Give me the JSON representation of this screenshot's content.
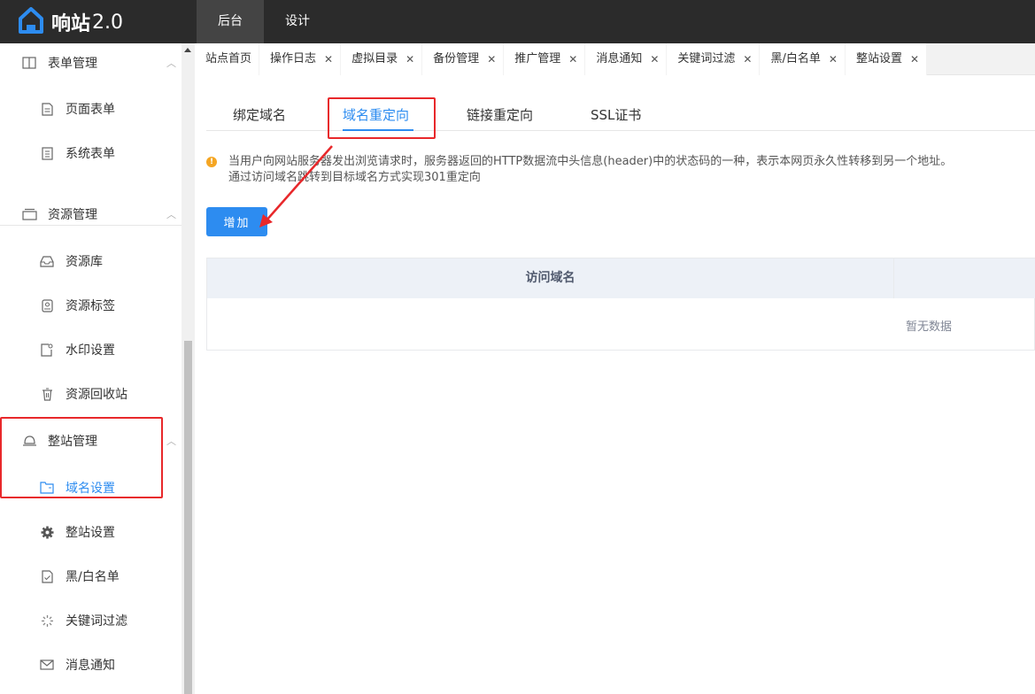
{
  "app": {
    "name": "响站",
    "version": "2.0",
    "logo_icon": "house-logo-icon",
    "brand_color": "#2d8cf0"
  },
  "topnav": [
    {
      "label": "后台",
      "active": true
    },
    {
      "label": "设计",
      "active": false
    }
  ],
  "sidebar": {
    "groups": [
      {
        "label": "表单管理",
        "icon": "book-icon",
        "items": [
          {
            "label": "页面表单",
            "icon": "file-icon"
          },
          {
            "label": "系统表单",
            "icon": "list-file-icon"
          }
        ]
      },
      {
        "label": "资源管理",
        "icon": "folder-icon",
        "items": [
          {
            "label": "资源库",
            "icon": "inbox-icon"
          },
          {
            "label": "资源标签",
            "icon": "tag-icon"
          },
          {
            "label": "水印设置",
            "icon": "watermark-icon"
          },
          {
            "label": "资源回收站",
            "icon": "trash-icon"
          }
        ]
      },
      {
        "label": "整站管理",
        "icon": "bell-icon",
        "items": [
          {
            "label": "域名设置",
            "icon": "domain-icon",
            "active": true
          },
          {
            "label": "整站设置",
            "icon": "gear-icon"
          },
          {
            "label": "黑/白名单",
            "icon": "checklist-icon"
          },
          {
            "label": "关键词过滤",
            "icon": "spinner-icon"
          },
          {
            "label": "消息通知",
            "icon": "mail-icon"
          }
        ]
      }
    ]
  },
  "tabs": [
    {
      "label": "站点首页",
      "closable": false
    },
    {
      "label": "操作日志",
      "closable": true
    },
    {
      "label": "虚拟目录",
      "closable": true
    },
    {
      "label": "备份管理",
      "closable": true
    },
    {
      "label": "推广管理",
      "closable": true
    },
    {
      "label": "消息通知",
      "closable": true
    },
    {
      "label": "关键词过滤",
      "closable": true
    },
    {
      "label": "黑/白名单",
      "closable": true
    },
    {
      "label": "整站设置",
      "closable": true
    }
  ],
  "subtabs": [
    {
      "label": "绑定域名",
      "active": false
    },
    {
      "label": "域名重定向",
      "active": true
    },
    {
      "label": "链接重定向",
      "active": false
    },
    {
      "label": "SSL证书",
      "active": false
    }
  ],
  "notice": {
    "line1": "当用户向网站服务器发出浏览请求时，服务器返回的HTTP数据流中头信息(header)中的状态码的一种，表示本网页永久性转移到另一个地址。",
    "line2": "通过访问域名跳转到目标域名方式实现301重定向"
  },
  "add_button": "增加",
  "table": {
    "columns": [
      "访问域名",
      ""
    ],
    "empty_text": "暂无数据"
  },
  "colors": {
    "accent": "#2d8cf0",
    "highlight": "#e8282b",
    "topbar": "#2b2b2b"
  }
}
